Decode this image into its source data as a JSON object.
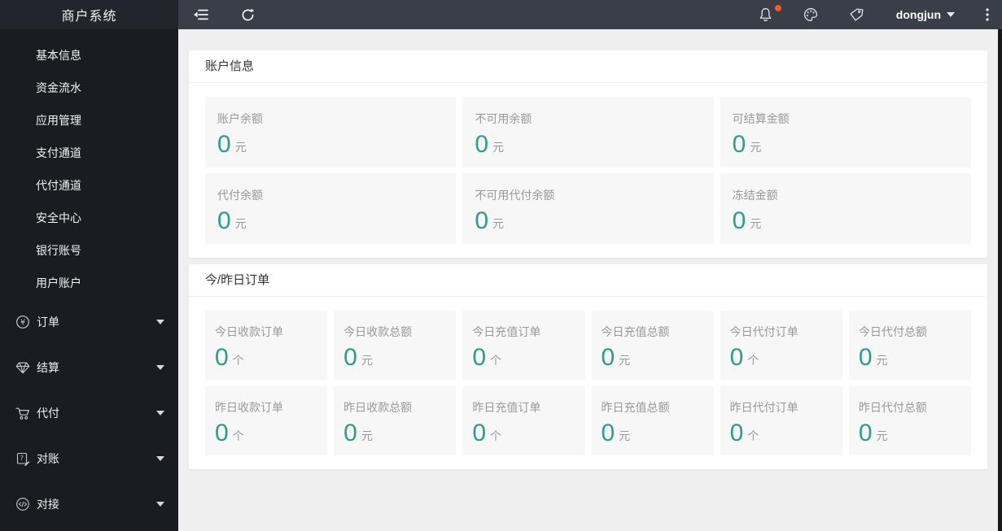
{
  "app": {
    "title": "商户系统"
  },
  "topbar": {
    "user": {
      "name": "dongjun"
    },
    "colors": {
      "notification_dot": "#FF5722",
      "bar_bg": "#3A3E48"
    }
  },
  "sidebar": {
    "items": [
      {
        "label": "基本信息"
      },
      {
        "label": "资金流水"
      },
      {
        "label": "应用管理"
      },
      {
        "label": "支付通道"
      },
      {
        "label": "代付通道"
      },
      {
        "label": "安全中心"
      },
      {
        "label": "银行账号"
      },
      {
        "label": "用户账户"
      }
    ],
    "groups": [
      {
        "label": "订单",
        "icon": "cny-circle-icon"
      },
      {
        "label": "结算",
        "icon": "gem-icon"
      },
      {
        "label": "代付",
        "icon": "cart-icon"
      },
      {
        "label": "对账",
        "icon": "form-edit-icon"
      },
      {
        "label": "对接",
        "icon": "api-code-icon"
      }
    ]
  },
  "account_card": {
    "title": "账户信息",
    "stats": [
      {
        "label": "账户余额",
        "value": "0",
        "unit": "元"
      },
      {
        "label": "不可用余额",
        "value": "0",
        "unit": "元"
      },
      {
        "label": "可结算金额",
        "value": "0",
        "unit": "元"
      },
      {
        "label": "代付余额",
        "value": "0",
        "unit": "元"
      },
      {
        "label": "不可用代付余额",
        "value": "0",
        "unit": "元"
      },
      {
        "label": "冻结金额",
        "value": "0",
        "unit": "元"
      }
    ]
  },
  "orders_card": {
    "title": "今/昨日订单",
    "stats": [
      {
        "label": "今日收款订单",
        "value": "0",
        "unit": "个"
      },
      {
        "label": "今日收款总额",
        "value": "0",
        "unit": "元"
      },
      {
        "label": "今日充值订单",
        "value": "0",
        "unit": "个"
      },
      {
        "label": "今日充值总额",
        "value": "0",
        "unit": "元"
      },
      {
        "label": "今日代付订单",
        "value": "0",
        "unit": "个"
      },
      {
        "label": "今日代付总额",
        "value": "0",
        "unit": "元"
      },
      {
        "label": "昨日收款订单",
        "value": "0",
        "unit": "个"
      },
      {
        "label": "昨日收款总额",
        "value": "0",
        "unit": "元"
      },
      {
        "label": "昨日充值订单",
        "value": "0",
        "unit": "个"
      },
      {
        "label": "昨日充值总额",
        "value": "0",
        "unit": "元"
      },
      {
        "label": "昨日代付订单",
        "value": "0",
        "unit": "个"
      },
      {
        "label": "昨日代付总额",
        "value": "0",
        "unit": "元"
      }
    ]
  },
  "colors": {
    "accent_teal": "#2A9D8F",
    "label_gray": "#999999",
    "sidebar_bg": "#1A1C21"
  }
}
